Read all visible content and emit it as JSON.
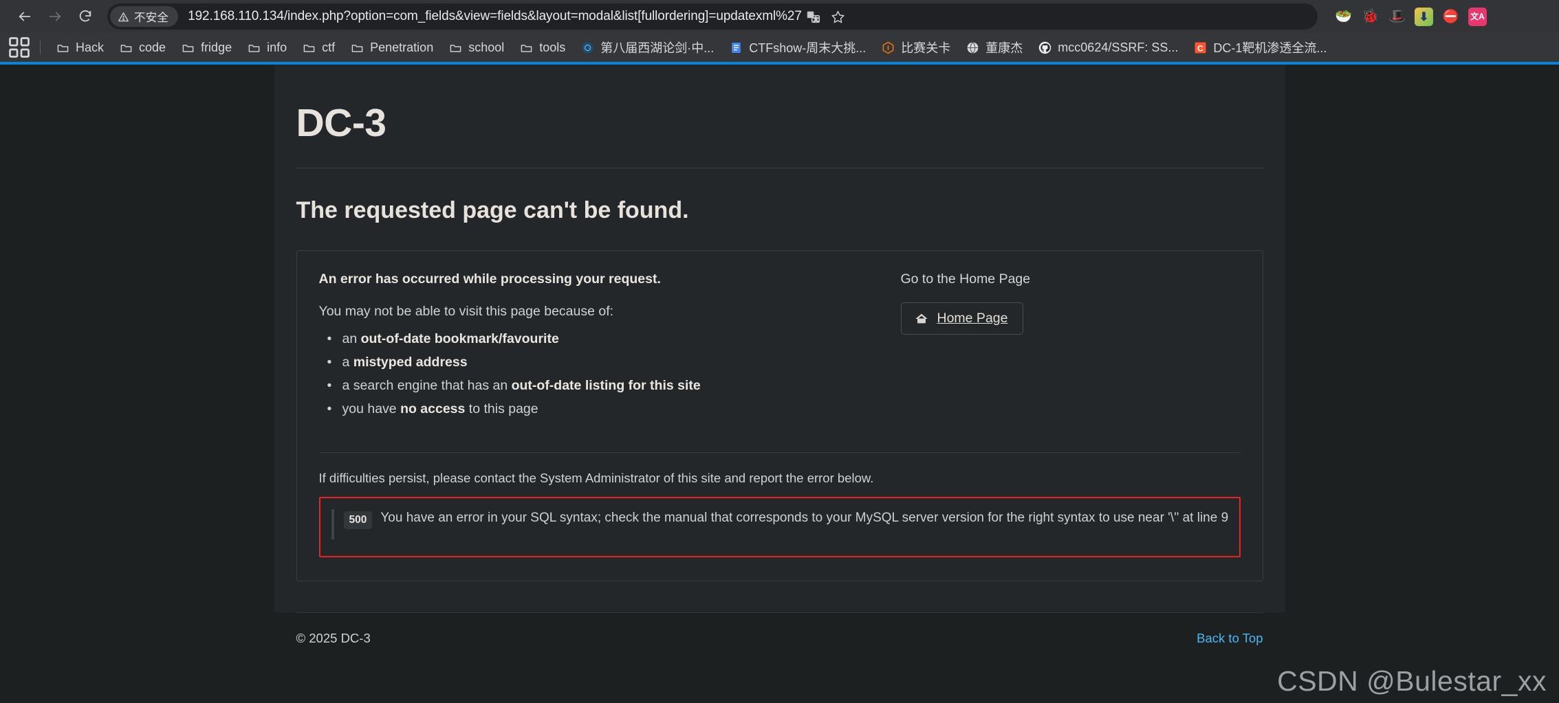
{
  "browser": {
    "nav": {
      "back_label": "Back",
      "forward_label": "Forward",
      "reload_label": "Reload"
    },
    "omnibox": {
      "security_label": "不安全",
      "security_icon": "warning-triangle-icon",
      "url": "192.168.110.134/index.php?option=com_fields&view=fields&layout=modal&list[fullordering]=updatexml%27",
      "translate_icon": "translate-icon",
      "bookmark_icon": "star-icon"
    },
    "extensions": [
      {
        "name": "salad-bowl-extension-icon",
        "glyph": "🥗"
      },
      {
        "name": "bug-extension-icon",
        "glyph": "🐞"
      },
      {
        "name": "black-hat-extension-icon",
        "glyph": "🎩"
      },
      {
        "name": "downloader-extension-icon",
        "glyph": "⬇"
      },
      {
        "name": "adblock-extension-icon",
        "glyph": "⛔"
      },
      {
        "name": "chinese-translate-extension-icon",
        "glyph": "文A"
      }
    ],
    "bookmarks": {
      "apps_label": "Apps",
      "items": [
        {
          "label": "Hack",
          "icon": "folder-icon"
        },
        {
          "label": "code",
          "icon": "folder-icon"
        },
        {
          "label": "fridge",
          "icon": "folder-icon"
        },
        {
          "label": "info",
          "icon": "folder-icon"
        },
        {
          "label": "ctf",
          "icon": "folder-icon"
        },
        {
          "label": "Penetration",
          "icon": "folder-icon"
        },
        {
          "label": "school",
          "icon": "folder-icon"
        },
        {
          "label": "tools",
          "icon": "folder-icon"
        },
        {
          "label": "第八届西湖论剑·中...",
          "icon": "site-icon"
        },
        {
          "label": "CTFshow-周末大挑...",
          "icon": "docs-icon"
        },
        {
          "label": "比赛关卡",
          "icon": "hexagon-icon"
        },
        {
          "label": "董康杰",
          "icon": "globe-icon"
        },
        {
          "label": "mcc0624/SSRF: SS...",
          "icon": "github-icon"
        },
        {
          "label": "DC-1靶机渗透全流...",
          "icon": "csdn-icon"
        }
      ]
    }
  },
  "page": {
    "site_title": "DC-3",
    "heading": "The requested page can't be found.",
    "error_panel": {
      "lead": "An error has occurred while processing your request.",
      "intro": "You may not be able to visit this page because of:",
      "reasons": [
        {
          "pre": "an ",
          "strong": "out-of-date bookmark/favourite",
          "post": ""
        },
        {
          "pre": "a ",
          "strong": "mistyped address",
          "post": ""
        },
        {
          "pre": "a search engine that has an ",
          "strong": "out-of-date listing for this site",
          "post": ""
        },
        {
          "pre": "you have ",
          "strong": "no access",
          "post": " to this page"
        }
      ],
      "home_title": "Go to the Home Page",
      "home_button_label": "Home Page",
      "home_button_icon": "home-icon",
      "persist_text": "If difficulties persist, please contact the System Administrator of this site and report the error below.",
      "error_code": "500",
      "error_message": "You have an error in your SQL syntax; check the manual that corresponds to your MySQL server version for the right syntax to use near '\\'' at line 9",
      "error_border_color": "#f02020"
    },
    "footer": {
      "copyright": "© 2025 DC-3",
      "back_to_top": "Back to Top",
      "back_to_top_color": "#49b9f5"
    }
  },
  "watermark": "CSDN @Bulestar_xx"
}
